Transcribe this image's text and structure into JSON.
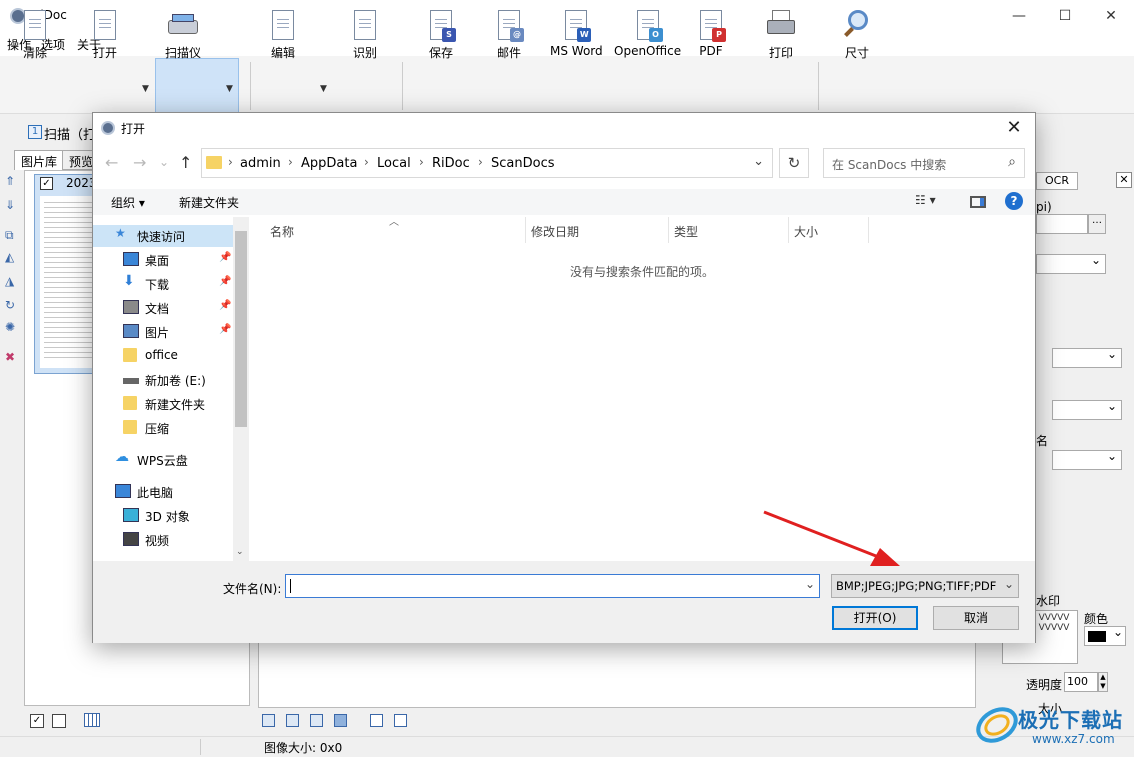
{
  "app": {
    "title": "RiDoc",
    "window_controls": {
      "minimize": "—",
      "maximize": "☐",
      "close": "✕"
    },
    "menu": [
      "操作",
      "选项",
      "关于"
    ],
    "toolbar": [
      {
        "label": "清除",
        "icon": "clear-icon"
      },
      {
        "label": "打开",
        "icon": "open-icon"
      },
      {
        "label": "扫描仪",
        "icon": "scanner-icon"
      },
      {
        "label": "编辑",
        "icon": "edit-icon"
      },
      {
        "label": "识别",
        "icon": "recognize-icon"
      },
      {
        "label": "保存",
        "icon": "save-icon"
      },
      {
        "label": "邮件",
        "icon": "mail-icon"
      },
      {
        "label": "MS Word",
        "icon": "word-icon"
      },
      {
        "label": "OpenOffice",
        "icon": "openoffice-icon"
      },
      {
        "label": "PDF",
        "icon": "pdf-icon"
      },
      {
        "label": "打印",
        "icon": "print-icon"
      },
      {
        "label": "尺寸",
        "icon": "zoom-icon"
      }
    ],
    "scan_step_num": "1",
    "scan_step_label": "扫描（打",
    "tabs": [
      "图片库",
      "预览"
    ],
    "thumbnail_label": "2023",
    "right_panel": {
      "tab": "OCR",
      "dpi_fragment": "pi)",
      "name_fragment": "名",
      "watermark_label": "水印",
      "color_label": "颜色",
      "opacity_label": "透明度",
      "opacity_value": "100",
      "size_label": "大小"
    },
    "status_image_size": "图像大小: 0x0"
  },
  "dialog": {
    "title": "打开",
    "close": "✕",
    "nav": {
      "back": "←",
      "forward": "→",
      "recent": "⌄",
      "up": "↑"
    },
    "breadcrumb": [
      "admin",
      "AppData",
      "Local",
      "RiDoc",
      "ScanDocs"
    ],
    "search_placeholder": "在 ScanDocs 中搜索",
    "organize": "组织 ▾",
    "new_folder": "新建文件夹",
    "view_icon": "☷ ▾",
    "help": "?",
    "nav_pane": [
      {
        "label": "快速访问",
        "icon": "star-icon",
        "pinned": false,
        "color": "#3a86d8"
      },
      {
        "label": "桌面",
        "icon": "desktop-icon",
        "pinned": true,
        "color": "#3a86d8"
      },
      {
        "label": "下载",
        "icon": "download-icon",
        "pinned": true,
        "color": "#2f7fd6"
      },
      {
        "label": "文档",
        "icon": "document-icon",
        "pinned": true,
        "color": "#8a8a8a"
      },
      {
        "label": "图片",
        "icon": "pictures-icon",
        "pinned": true,
        "color": "#5a8ac6"
      },
      {
        "label": "office",
        "icon": "folder-icon",
        "pinned": false,
        "color": "#f6d365"
      },
      {
        "label": "新加卷 (E:)",
        "icon": "drive-icon",
        "pinned": false,
        "color": "#666666"
      },
      {
        "label": "新建文件夹",
        "icon": "folder-icon",
        "pinned": false,
        "color": "#f6d365"
      },
      {
        "label": "压缩",
        "icon": "folder-icon",
        "pinned": false,
        "color": "#f6d365"
      },
      {
        "label": "WPS云盘",
        "icon": "cloud-icon",
        "pinned": false,
        "color": "#2f8fe0"
      },
      {
        "label": "此电脑",
        "icon": "computer-icon",
        "pinned": false,
        "color": "#3a86d8"
      },
      {
        "label": "3D 对象",
        "icon": "3d-objects-icon",
        "pinned": false,
        "color": "#3ab0d8"
      },
      {
        "label": "视频",
        "icon": "video-icon",
        "pinned": false,
        "color": "#444444"
      }
    ],
    "columns": [
      "名称",
      "修改日期",
      "类型",
      "大小"
    ],
    "empty_message": "没有与搜索条件匹配的项。",
    "filename_label": "文件名(N):",
    "filename_value": "",
    "filter": "BMP;JPEG;JPG;PNG;TIFF;PDF",
    "open_button": "打开(O)",
    "cancel_button": "取消"
  },
  "annotation_arrow_color": "#e02020",
  "watermark": {
    "text": "极光下载站",
    "url": "www.xz7.com"
  }
}
